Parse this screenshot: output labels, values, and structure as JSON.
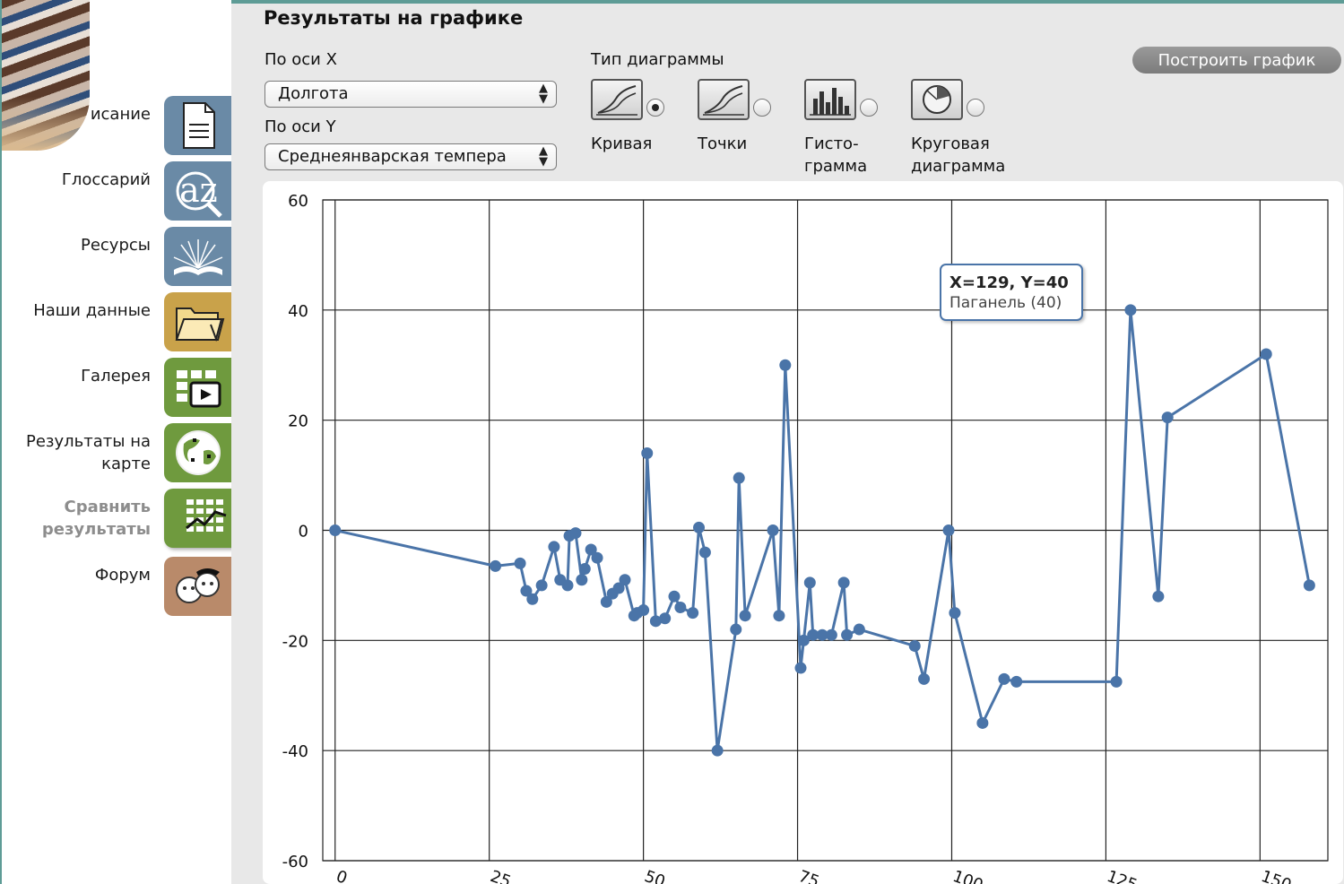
{
  "sidebar": {
    "items": [
      {
        "label": "исание",
        "icon": "document-icon",
        "color": "#6a8aa6"
      },
      {
        "label": "Глоссарий",
        "icon": "az-magnifier-icon",
        "color": "#6a8aa6"
      },
      {
        "label": "Ресурсы",
        "icon": "open-book-icon",
        "color": "#6a8aa6"
      },
      {
        "label": "Наши данные",
        "icon": "folder-icon",
        "color": "#c9a24a"
      },
      {
        "label": "Галерея",
        "icon": "gallery-video-icon",
        "color": "#6f9a3e"
      },
      {
        "label": "Результаты на\nкарте",
        "icon": "globe-icon",
        "color": "#6f9a3e"
      },
      {
        "label": "Сравнить\nрезультаты",
        "icon": "compare-chart-icon",
        "color": "#6f9a3e",
        "active": true
      },
      {
        "label": "Форум",
        "icon": "forum-kids-icon",
        "color": "#b98a6a"
      }
    ]
  },
  "main": {
    "title": "Результаты на графике",
    "x_axis_label": "По оси X",
    "x_axis_value": "Долгота",
    "y_axis_label": "По оси Y",
    "y_axis_value": "Среднеянварская темпера",
    "chart_type_label": "Тип диаграммы",
    "build_button": "Построить график",
    "chart_types": [
      {
        "label": "Кривая",
        "icon": "line-curve-icon",
        "selected": true
      },
      {
        "label": "Точки",
        "icon": "points-icon",
        "selected": false
      },
      {
        "label": "Гисто-\nграмма",
        "icon": "histogram-icon",
        "selected": false
      },
      {
        "label": "Круговая\nдиаграмма",
        "icon": "pie-icon",
        "selected": false
      }
    ]
  },
  "tooltip": {
    "title": "X=129, Y=40",
    "subtitle": "Паганель (40)"
  },
  "chart_data": {
    "type": "line",
    "series_color": "#4a74a8",
    "grid": true,
    "xlim": [
      -2,
      161
    ],
    "ylim": [
      -60,
      60
    ],
    "x_ticks": [
      0,
      25,
      50,
      75,
      100,
      125,
      150
    ],
    "y_ticks": [
      60,
      40,
      20,
      0,
      -20,
      -40,
      -60
    ],
    "x": [
      0,
      26,
      30,
      31,
      32,
      33.5,
      35.5,
      36.5,
      37.7,
      38,
      39,
      40,
      40.5,
      41.5,
      42.5,
      44,
      45,
      46,
      47,
      48.5,
      49,
      50,
      50.6,
      52,
      53.5,
      55,
      56,
      58,
      59,
      60,
      62,
      65,
      65.5,
      66.5,
      71,
      72,
      73,
      75.5,
      76,
      77,
      77.5,
      79,
      80.5,
      82.5,
      83,
      85,
      94,
      95.5,
      99.5,
      100.5,
      105,
      108.5,
      110.5,
      126.7,
      129,
      133.5,
      135,
      151,
      158
    ],
    "y": [
      0,
      -6.5,
      -6,
      -11,
      -12.5,
      -10,
      -3,
      -9,
      -10,
      -1,
      -0.5,
      -9,
      -7,
      -3.5,
      -5,
      -13,
      -11.5,
      -10.5,
      -9,
      -15.5,
      -15,
      -14.5,
      14,
      -16.5,
      -16,
      -12,
      -14,
      -15,
      0.5,
      -4,
      -40,
      -18,
      9.5,
      -15.5,
      0,
      -15.5,
      30,
      -25,
      -20,
      -9.5,
      -19,
      -19,
      -19,
      -9.5,
      -19,
      -18,
      -21,
      -27,
      0,
      -15,
      -35,
      -27,
      -27.5,
      -27.5,
      40,
      -12,
      20.5,
      32,
      -10
    ]
  }
}
